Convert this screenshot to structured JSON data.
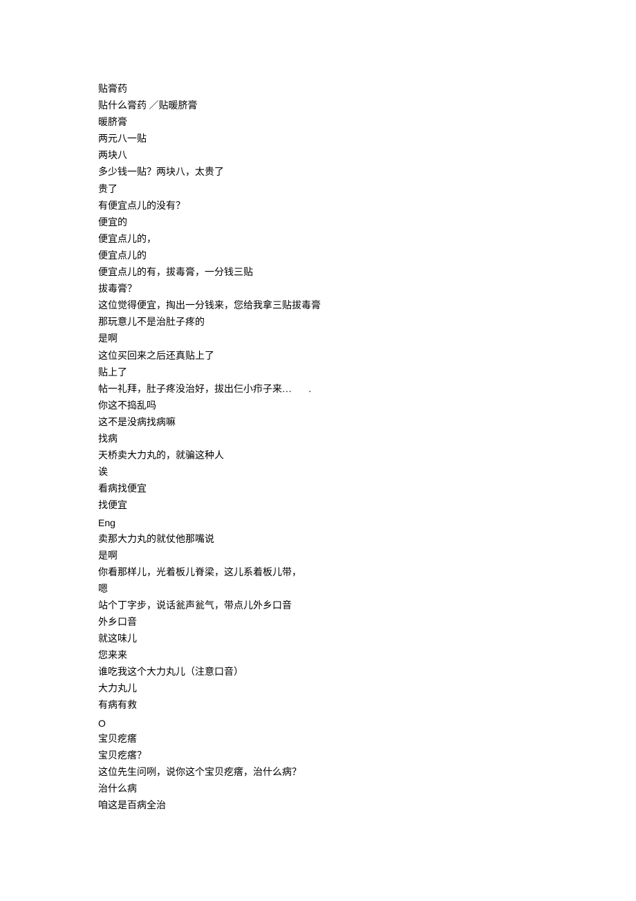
{
  "lines": [
    "贴膏药",
    "贴什么膏药 ／贴暖脐膏",
    "暖脐膏",
    "两元八一贴",
    "两块八",
    "多少钱一贴？两块八，太贵了",
    "贵了",
    "有便宜点儿的没有？",
    "便宜的",
    "便宜点儿的，",
    "便宜点儿的",
    "便宜点儿的有，拔毒膏，一分钱三贴",
    "拔毒膏？",
    "这位觉得便宜，掏出一分钱来，您给我拿三贴拔毒膏",
    "那玩意儿不是治肚子疼的",
    "是啊",
    "这位买回来之后还真贴上了",
    "贴上了",
    "帖一礼拜，肚子疼没治好，拔出仨小疖子来…       .",
    "你这不捣乱吗",
    "这不是没病找病嘛",
    "找病",
    "天桥卖大力丸的，就骗这种人",
    "诶",
    "看病找便宜",
    "找便宜",
    "Eng",
    "卖那大力丸的就仗他那嘴说",
    "是啊",
    "你看那样儿，光着板儿脊梁，这儿系着板儿带，",
    "嗯",
    "站个丁字步，说话瓮声瓮气，带点儿外乡口音",
    "外乡口音",
    "就这味儿",
    "您来来",
    "谁吃我这个大力丸儿（注意口音）",
    "大力丸儿",
    "有病有救",
    "O",
    "宝贝疙瘩",
    "宝贝疙瘩？",
    "这位先生问咧，说你这个宝贝疙瘩，治什么病？",
    "治什么病",
    "咱这是百病全治"
  ]
}
